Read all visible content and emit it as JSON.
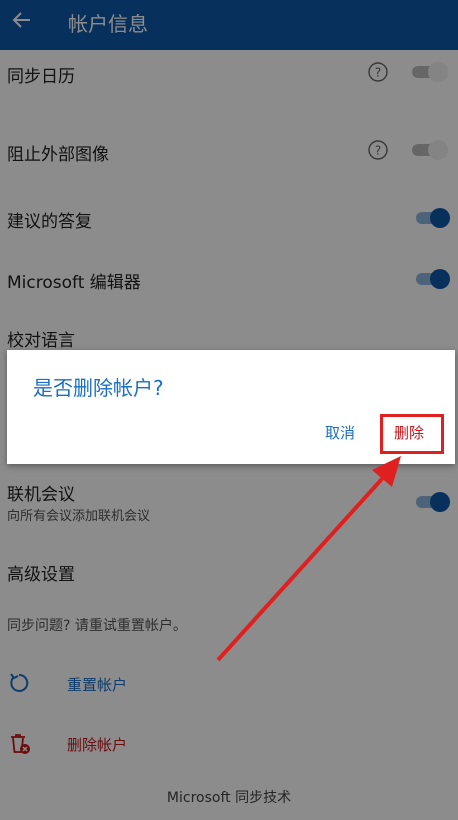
{
  "appbar": {
    "title": "帐户信息"
  },
  "settings": [
    {
      "label": "同步日历",
      "help": true,
      "toggle": "off"
    },
    {
      "label": "阻止外部图像",
      "help": true,
      "toggle": "off"
    },
    {
      "label": "建议的答复",
      "toggle": "on"
    },
    {
      "label": "Microsoft 编辑器",
      "toggle": "on"
    },
    {
      "label": "校对语言"
    },
    {
      "label": "联机会议",
      "sublabel": "向所有会议添加联机会议",
      "toggle": "on"
    },
    {
      "label": "高级设置"
    }
  ],
  "sync_hint": "同步问题? 请重试重置帐户。",
  "actions": [
    {
      "label": "重置帐户",
      "icon": "refresh-icon",
      "color": "#1a6fc4"
    },
    {
      "label": "删除帐户",
      "icon": "trash-icon",
      "color": "#c4161c"
    }
  ],
  "footer": "Microsoft 同步技术",
  "dialog": {
    "title": "是否删除帐户?",
    "cancel": "取消",
    "delete": "删除"
  },
  "colors": {
    "brand": "#0e5aa8",
    "accent": "#1a6fc4",
    "danger": "#c4161c",
    "annotation": "#e02020"
  }
}
